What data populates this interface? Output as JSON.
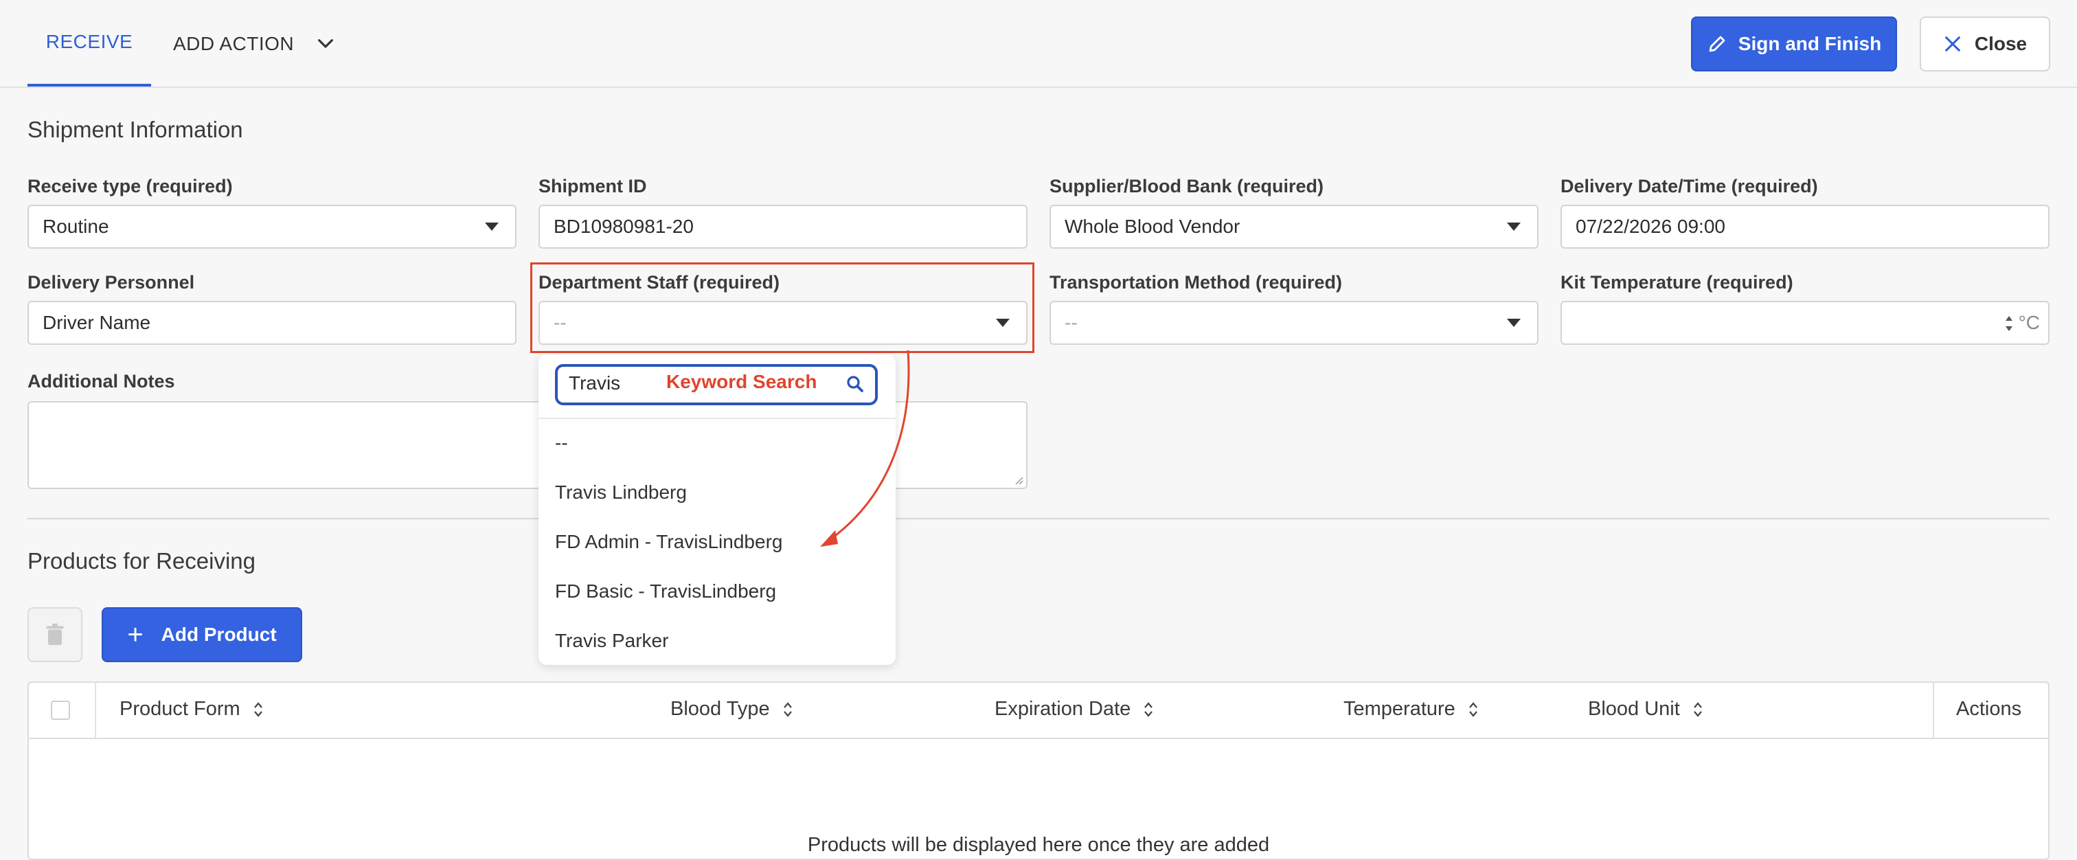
{
  "header": {
    "tab_receive": "RECEIVE",
    "tab_add_action": "ADD ACTION",
    "sign_button": "Sign and Finish",
    "close_button": "Close"
  },
  "shipment": {
    "title": "Shipment Information",
    "receive_type_label": "Receive type (required)",
    "receive_type_value": "Routine",
    "shipment_id_label": "Shipment ID",
    "shipment_id_value": "BD10980981-20",
    "supplier_label": "Supplier/Blood Bank (required)",
    "supplier_value": "Whole Blood Vendor",
    "delivery_dt_label": "Delivery Date/Time (required)",
    "delivery_dt_value": "07/22/2026 09:00",
    "personnel_label": "Delivery Personnel",
    "personnel_value": "Driver Name",
    "dept_staff_label": "Department Staff (required)",
    "dept_staff_value": "--",
    "transport_label": "Transportation Method (required)",
    "transport_value": "--",
    "kit_temp_label": "Kit Temperature (required)",
    "kit_temp_unit": "°C",
    "notes_label": "Additional Notes"
  },
  "dropdown": {
    "search_value": "Travis",
    "annotation": "Keyword Search",
    "options": [
      "--",
      "Travis Lindberg",
      "FD Admin - TravisLindberg",
      "FD Basic - TravisLindberg",
      "Travis Parker"
    ]
  },
  "products": {
    "title": "Products for Receiving",
    "add_button": "Add Product",
    "columns": [
      "Product Form",
      "Blood Type",
      "Expiration Date",
      "Temperature",
      "Blood Unit",
      "Actions"
    ],
    "empty_message": "Products will be displayed here once they are added"
  },
  "colors": {
    "primary": "#3462e0",
    "annotation": "#e0452e"
  }
}
